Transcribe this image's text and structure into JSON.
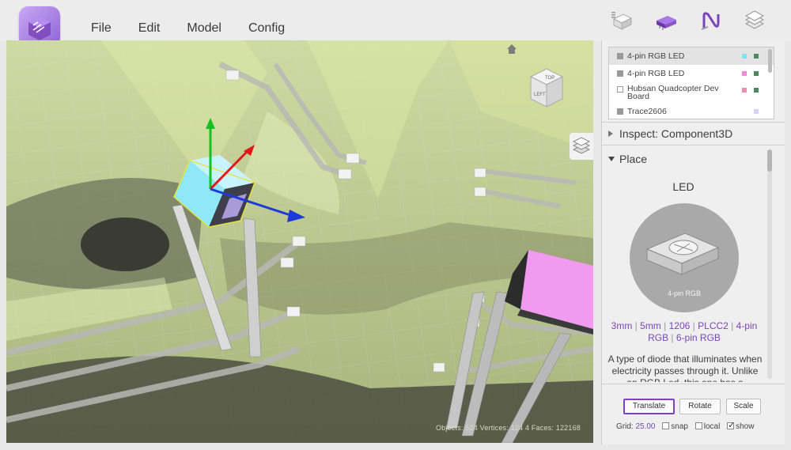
{
  "menu": {
    "file": "File",
    "edit": "Edit",
    "model": "Model",
    "config": "Config"
  },
  "viewport": {
    "stats": "Objects: 524  Vertices: 124 4  Faces: 122168",
    "cube_top": "TOP",
    "cube_left": "LEFT"
  },
  "components": [
    {
      "label": "4-pin RGB LED",
      "colors": [
        "#7fe4f0",
        "#4a8a5c"
      ]
    },
    {
      "label": "4-pin RGB LED",
      "colors": [
        "#f08ad8",
        "#4a8a5c"
      ]
    },
    {
      "label": "Hubsan Quadcopter Dev Board",
      "colors": [
        "#f08ab0",
        "#4a8a5c"
      ]
    },
    {
      "label": "Trace2606",
      "colors": [
        "#d8d0f8"
      ]
    }
  ],
  "inspect": {
    "label": "Inspect: Component3D"
  },
  "place": {
    "header": "Place",
    "component_title": "LED",
    "component_caption": "4-pin RGB",
    "variants": [
      "3mm",
      "5mm",
      "1206",
      "PLCC2",
      "4-pin RGB",
      "6-pin RGB"
    ],
    "description": "A type of diode that illuminates when electricity passes through it. Unlike an RGB Led, this one has a"
  },
  "transform": {
    "translate": "Translate",
    "rotate": "Rotate",
    "scale": "Scale"
  },
  "grid": {
    "label": "Grid:",
    "value": "25.00",
    "snap": "snap",
    "local": "local",
    "show": "show"
  },
  "colors": {
    "accent": "#7b45b8",
    "led_cyan": "#8ee8f8",
    "led_pink": "#f19bf0",
    "board": "#c8d8a0"
  }
}
